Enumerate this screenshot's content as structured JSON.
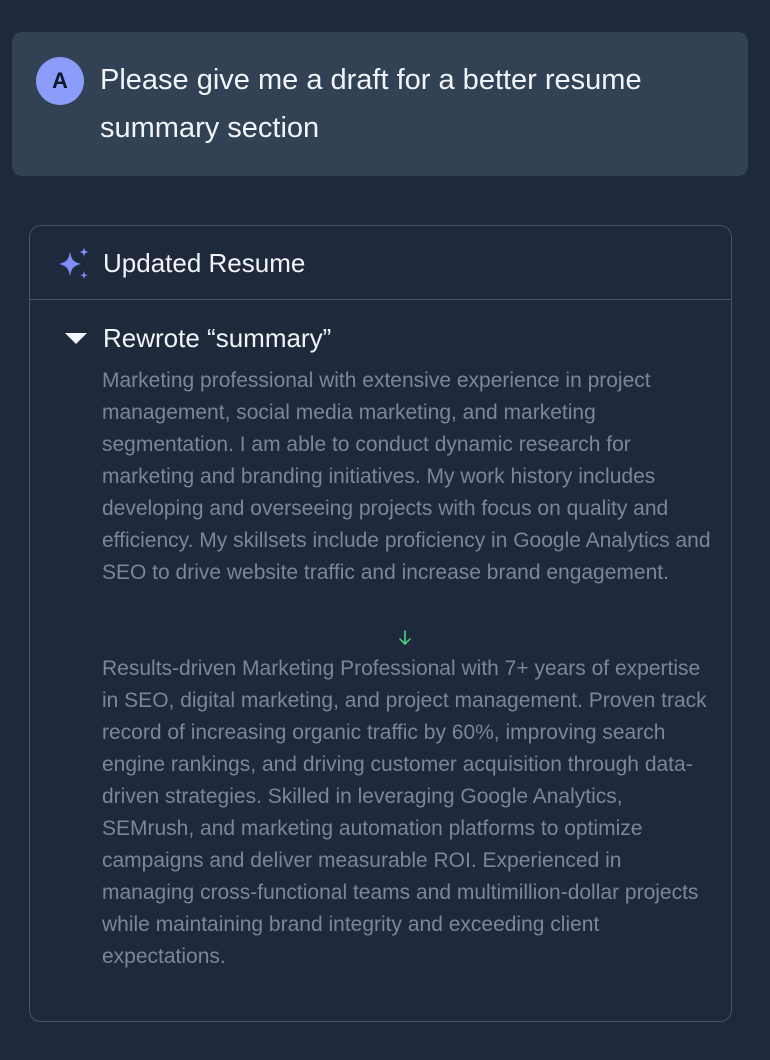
{
  "user_message": {
    "avatar_initial": "A",
    "text": "Please give me a draft for a better resume summary section"
  },
  "result_card": {
    "header_icon": "sparkle-icon",
    "title": "Updated Resume",
    "section": {
      "toggle_icon": "caret-down-icon",
      "title": "Rewrote “summary”",
      "old_text": "Marketing professional with extensive experience in project management, social media marketing, and marketing segmentation. I am able to conduct dynamic research for marketing and branding initiatives. My work history includes developing and overseeing projects with focus on quality and efficiency. My skillsets include proficiency in Google Analytics and SEO to drive website traffic and increase brand engagement.",
      "change_icon": "arrow-down-icon",
      "new_text": "Results-driven Marketing Professional with 7+ years of expertise in SEO, digital marketing, and project management. Proven track record of increasing organic traffic by 60%, improving search engine rankings, and driving customer acquisition through data-driven strategies. Skilled in leveraging Google Analytics, SEMrush, and marketing automation platforms to optimize campaigns and deliver measurable ROI. Experienced in managing cross-functional teams and multimillion-dollar projects while maintaining brand integrity and exceeding client expectations."
    }
  },
  "colors": {
    "background": "#1e293b",
    "user_bubble": "#334155",
    "avatar": "#8b9cf9",
    "accent_sparkle": "#818cf8",
    "muted_text": "#7b8797",
    "arrow": "#4ade80",
    "border": "#475569"
  }
}
